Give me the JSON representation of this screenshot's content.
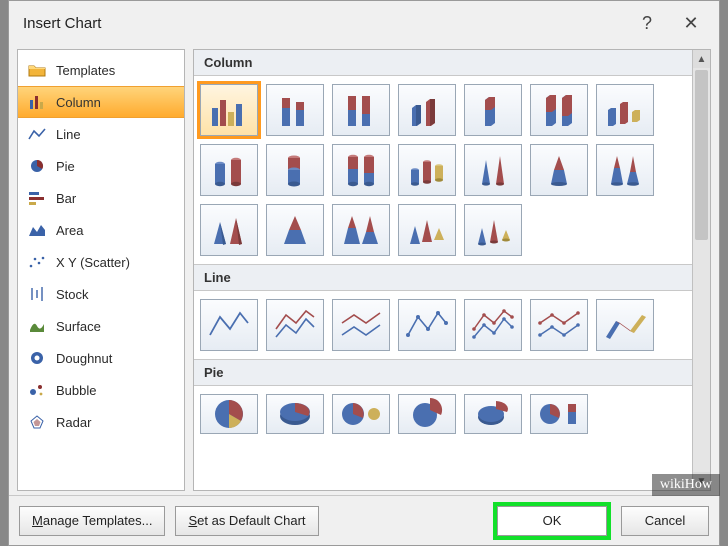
{
  "titlebar": {
    "title": "Insert Chart",
    "help": "?",
    "close": "✕"
  },
  "sidebar": {
    "items": [
      {
        "label": "Templates",
        "icon": "folder-icon"
      },
      {
        "label": "Column",
        "icon": "column-icon"
      },
      {
        "label": "Line",
        "icon": "line-icon"
      },
      {
        "label": "Pie",
        "icon": "pie-icon"
      },
      {
        "label": "Bar",
        "icon": "bar-icon"
      },
      {
        "label": "Area",
        "icon": "area-icon"
      },
      {
        "label": "X Y (Scatter)",
        "icon": "scatter-icon"
      },
      {
        "label": "Stock",
        "icon": "stock-icon"
      },
      {
        "label": "Surface",
        "icon": "surface-icon"
      },
      {
        "label": "Doughnut",
        "icon": "doughnut-icon"
      },
      {
        "label": "Bubble",
        "icon": "bubble-icon"
      },
      {
        "label": "Radar",
        "icon": "radar-icon"
      }
    ],
    "selected_index": 1
  },
  "gallery": {
    "sections": [
      {
        "title": "Column",
        "items": [
          "clustered-column",
          "stacked-column",
          "100pct-stacked-column",
          "3d-clustered-column",
          "3d-stacked-column",
          "3d-100pct-stacked-column",
          "3d-column",
          "clustered-cylinder",
          "stacked-cylinder",
          "100pct-stacked-cylinder",
          "3d-cylinder",
          "clustered-cone",
          "stacked-cone",
          "100pct-stacked-cone",
          "clustered-pyramid",
          "stacked-pyramid",
          "100pct-stacked-pyramid",
          "3d-pyramid",
          "3d-cone"
        ],
        "selected_index": 0
      },
      {
        "title": "Line",
        "items": [
          "line",
          "stacked-line",
          "100pct-stacked-line",
          "line-markers",
          "stacked-line-markers",
          "100pct-stacked-line-markers",
          "3d-line"
        ]
      },
      {
        "title": "Pie",
        "items": [
          "pie",
          "pie-3d",
          "pie-of-pie",
          "exploded-pie",
          "exploded-pie-3d",
          "bar-of-pie"
        ]
      }
    ]
  },
  "footer": {
    "manage_templates": "Manage Templates...",
    "set_default": "Set as Default Chart",
    "ok": "OK",
    "cancel": "Cancel"
  },
  "watermark": "wikiHow"
}
